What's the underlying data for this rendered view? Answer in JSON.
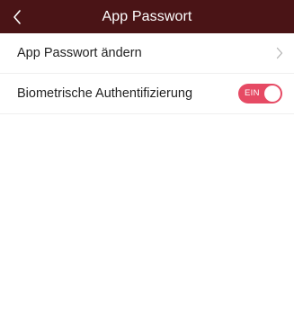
{
  "header": {
    "title": "App Passwort",
    "back_icon": "chevron-left-icon"
  },
  "settings": {
    "items": [
      {
        "label": "App Passwort ändern",
        "trailing_icon": "chevron-right-icon"
      },
      {
        "label": "Biometrische Authentifizierung",
        "toggle": {
          "state_label": "EIN",
          "on": true
        }
      }
    ]
  },
  "colors": {
    "header_background": "#4a1416",
    "toggle_on": "#e64a64"
  }
}
